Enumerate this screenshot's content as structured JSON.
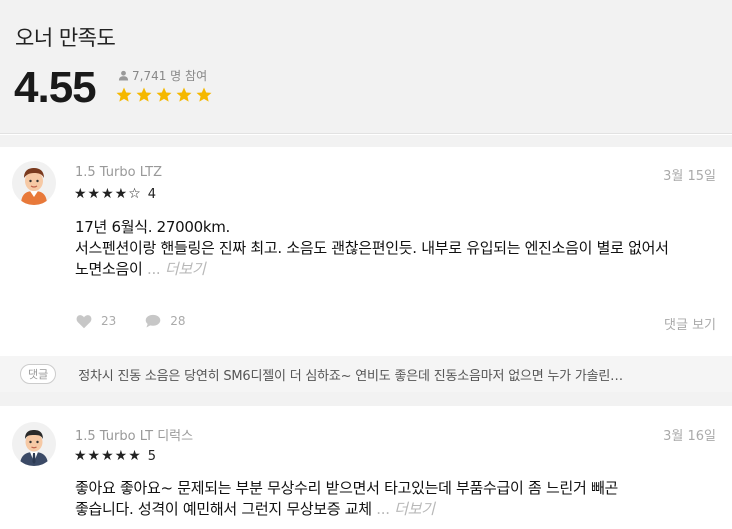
{
  "summary": {
    "title": "오너 만족도",
    "score": "4.55",
    "participants": "7,741 명 참여",
    "stars": 5
  },
  "reviews": [
    {
      "trim": "1.5 Turbo LTZ",
      "date": "3월 15일",
      "stars_text": "★★★★☆",
      "rating": "4",
      "line1": "17년 6월식. 27000km.",
      "line2": "서스펜션이랑 핸들링은 진짜 최고. 소음도 괜찮은편인듯. 내부로 유입되는 엔진소음이 별로 없어서",
      "line3": "노면소음이",
      "ellipsis": "...",
      "more": "더보기",
      "likes": "23",
      "comments": "28",
      "comment_link": "댓글 보기",
      "comment_badge": "댓글",
      "comment_preview": "정차시 진동 소음은 당연히 SM6디젤이 더 심하죠~ 연비도 좋은데 진동소음마저 없으면 누가 가솔린…"
    },
    {
      "trim": "1.5 Turbo LT 디럭스",
      "date": "3월 16일",
      "stars_text": "★★★★★",
      "rating": "5",
      "line1": "좋아요 좋아요~ 문제되는 부분 무상수리 받으면서 타고있는데 부품수급이 좀 느린거 빼곤",
      "line2": "좋습니다. 성격이 예민해서 그런지 무상보증 교체",
      "ellipsis": "...",
      "more": "더보기"
    }
  ],
  "colors": {
    "star_gold": "#f5b800",
    "background_gray": "#f2f2f2",
    "muted_text": "#aaaaaa"
  }
}
